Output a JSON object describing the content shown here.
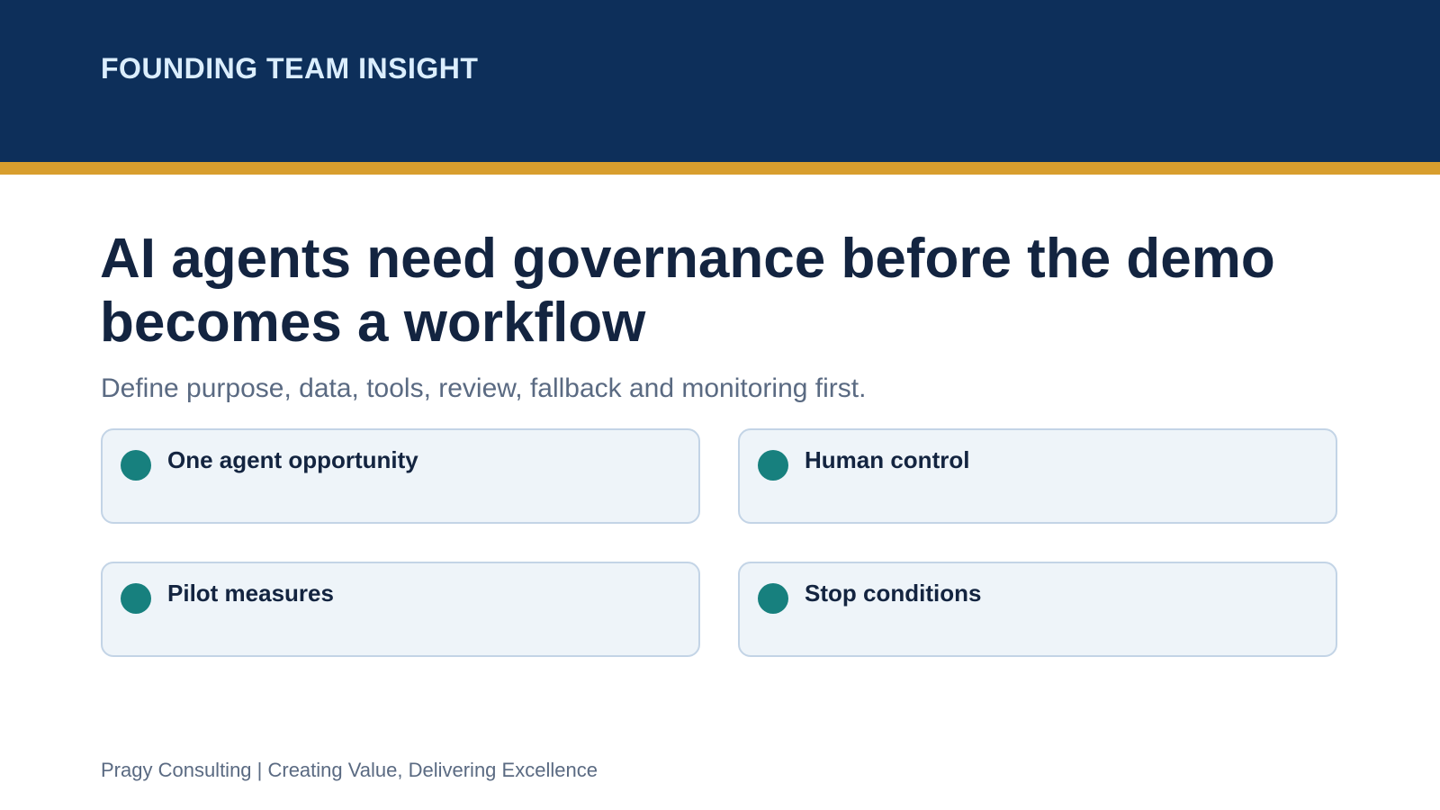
{
  "header": {
    "kicker": "FOUNDING TEAM INSIGHT"
  },
  "main": {
    "title": "AI agents need governance before the demo becomes a workflow",
    "subtitle": "Define purpose, data, tools, review, fallback and monitoring first.",
    "cards": [
      {
        "label": "One agent opportunity"
      },
      {
        "label": "Human control"
      },
      {
        "label": "Pilot measures"
      },
      {
        "label": "Stop conditions"
      }
    ]
  },
  "footer": {
    "text": "Pragy Consulting | Creating Value, Delivering Excellence"
  },
  "colors": {
    "header_bg": "#0d2f5a",
    "accent": "#d89e2e",
    "dot": "#17807e",
    "card_bg": "#eef4f9",
    "title": "#132440"
  }
}
